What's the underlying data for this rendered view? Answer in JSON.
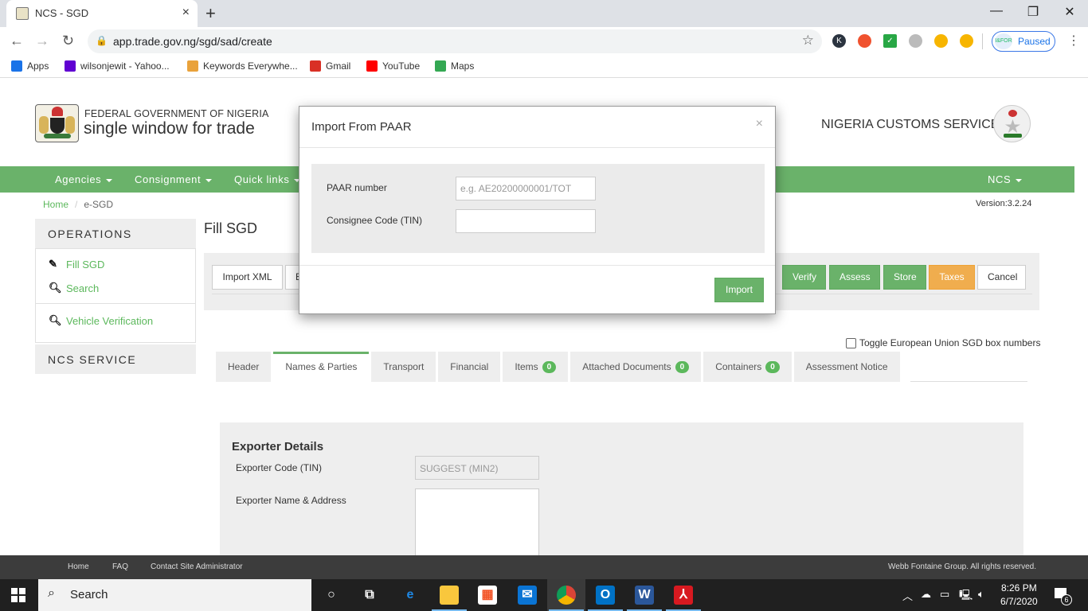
{
  "browser": {
    "tab_title": "NCS - SGD",
    "tab_close": "×",
    "new_tab": "+",
    "window_controls": {
      "minimize": "—",
      "restore": "❐",
      "close": "✕"
    },
    "nav": {
      "back": "←",
      "forward": "→",
      "reload": "↻"
    },
    "url": "app.trade.gov.ng/sgd/sad/create",
    "star": "☆",
    "extensions": [
      {
        "name": "k-extension",
        "color": "#2b3440",
        "glyph": "K"
      },
      {
        "name": "lighthouse-extension",
        "color": "#f0522f",
        "glyph": ""
      },
      {
        "name": "checkmark-extension",
        "color": "#28a745",
        "glyph": "✓"
      },
      {
        "name": "chat-extension",
        "color": "#bbbbbb",
        "glyph": ""
      },
      {
        "name": "search-extension",
        "color": "#f7b500",
        "glyph": ""
      },
      {
        "name": "home-extension",
        "color": "#f7b500",
        "glyph": ""
      }
    ],
    "profile_label": "Paused",
    "profile_avatar_text": "I&FOR",
    "menu": "⋮",
    "bookmarks": [
      {
        "label": "Apps",
        "color": "#1a73e8"
      },
      {
        "label": "wilsonjewit - Yahoo...",
        "color": "#6001d2"
      },
      {
        "label": "Keywords Everywhe...",
        "color": "#e9a23b"
      },
      {
        "label": "Gmail",
        "color": "#d93025"
      },
      {
        "label": "YouTube",
        "color": "#ff0000"
      },
      {
        "label": "Maps",
        "color": "#34a853"
      }
    ]
  },
  "header": {
    "gov_line": "FEDERAL GOVERNMENT OF NIGERIA",
    "brand": "single window for trade",
    "agency": "NIGERIA CUSTOMS SERVICE"
  },
  "navbar": {
    "items": [
      "Agencies",
      "Consignment",
      "Quick links"
    ],
    "right_item": "NCS",
    "color": "#6ab26a"
  },
  "breadcrumb": {
    "home": "Home",
    "separator": "/",
    "current": "e-SGD"
  },
  "version": "Version:3.2.24",
  "sidebar": {
    "operations_title": "OPERATIONS",
    "items": [
      {
        "label": "Fill SGD",
        "icon": "pencil"
      },
      {
        "label": "Search",
        "icon": "search"
      },
      {
        "label": "Vehicle Verification",
        "icon": "search"
      }
    ],
    "service_title": "NCS SERVICE"
  },
  "main": {
    "title": "Fill SGD",
    "actions": {
      "import_xml": "Import XML",
      "partial": "E",
      "verify": "Verify",
      "assess": "Assess",
      "store": "Store",
      "taxes": "Taxes",
      "cancel": "Cancel"
    },
    "eu_toggle_label": "Toggle European Union SGD box numbers",
    "eu_toggle_checked": false,
    "tabs": [
      {
        "label": "Header",
        "badge": null,
        "active": false
      },
      {
        "label": "Names & Parties",
        "badge": null,
        "active": true
      },
      {
        "label": "Transport",
        "badge": null,
        "active": false
      },
      {
        "label": "Financial",
        "badge": null,
        "active": false
      },
      {
        "label": "Items",
        "badge": "0",
        "active": false
      },
      {
        "label": "Attached Documents",
        "badge": "0",
        "active": false
      },
      {
        "label": "Containers",
        "badge": "0",
        "active": false
      },
      {
        "label": "Assessment Notice",
        "badge": null,
        "active": false
      }
    ],
    "exporter": {
      "title": "Exporter Details",
      "code_label": "Exporter Code (TIN)",
      "code_placeholder": "SUGGEST (MIN2)",
      "address_label": "Exporter Name & Address",
      "address_value": ""
    }
  },
  "modal": {
    "title": "Import From PAAR",
    "close": "×",
    "paar_label": "PAAR number",
    "paar_placeholder": "e.g. AE20200000001/TOT",
    "paar_value": "",
    "tin_label": "Consignee Code (TIN)",
    "tin_value": "",
    "import_button": "Import"
  },
  "footer": {
    "links": [
      "Home",
      "FAQ",
      "Contact Site Administrator"
    ],
    "copyright": "Webb Fontaine Group. All rights reserved."
  },
  "taskbar": {
    "search_label": "Search",
    "apps": [
      "cortana",
      "task-view",
      "edge",
      "file-explorer",
      "store",
      "mail",
      "chrome",
      "outlook",
      "word",
      "acrobat"
    ],
    "time": "8:26 PM",
    "date": "6/7/2020",
    "notification_count": "6"
  }
}
